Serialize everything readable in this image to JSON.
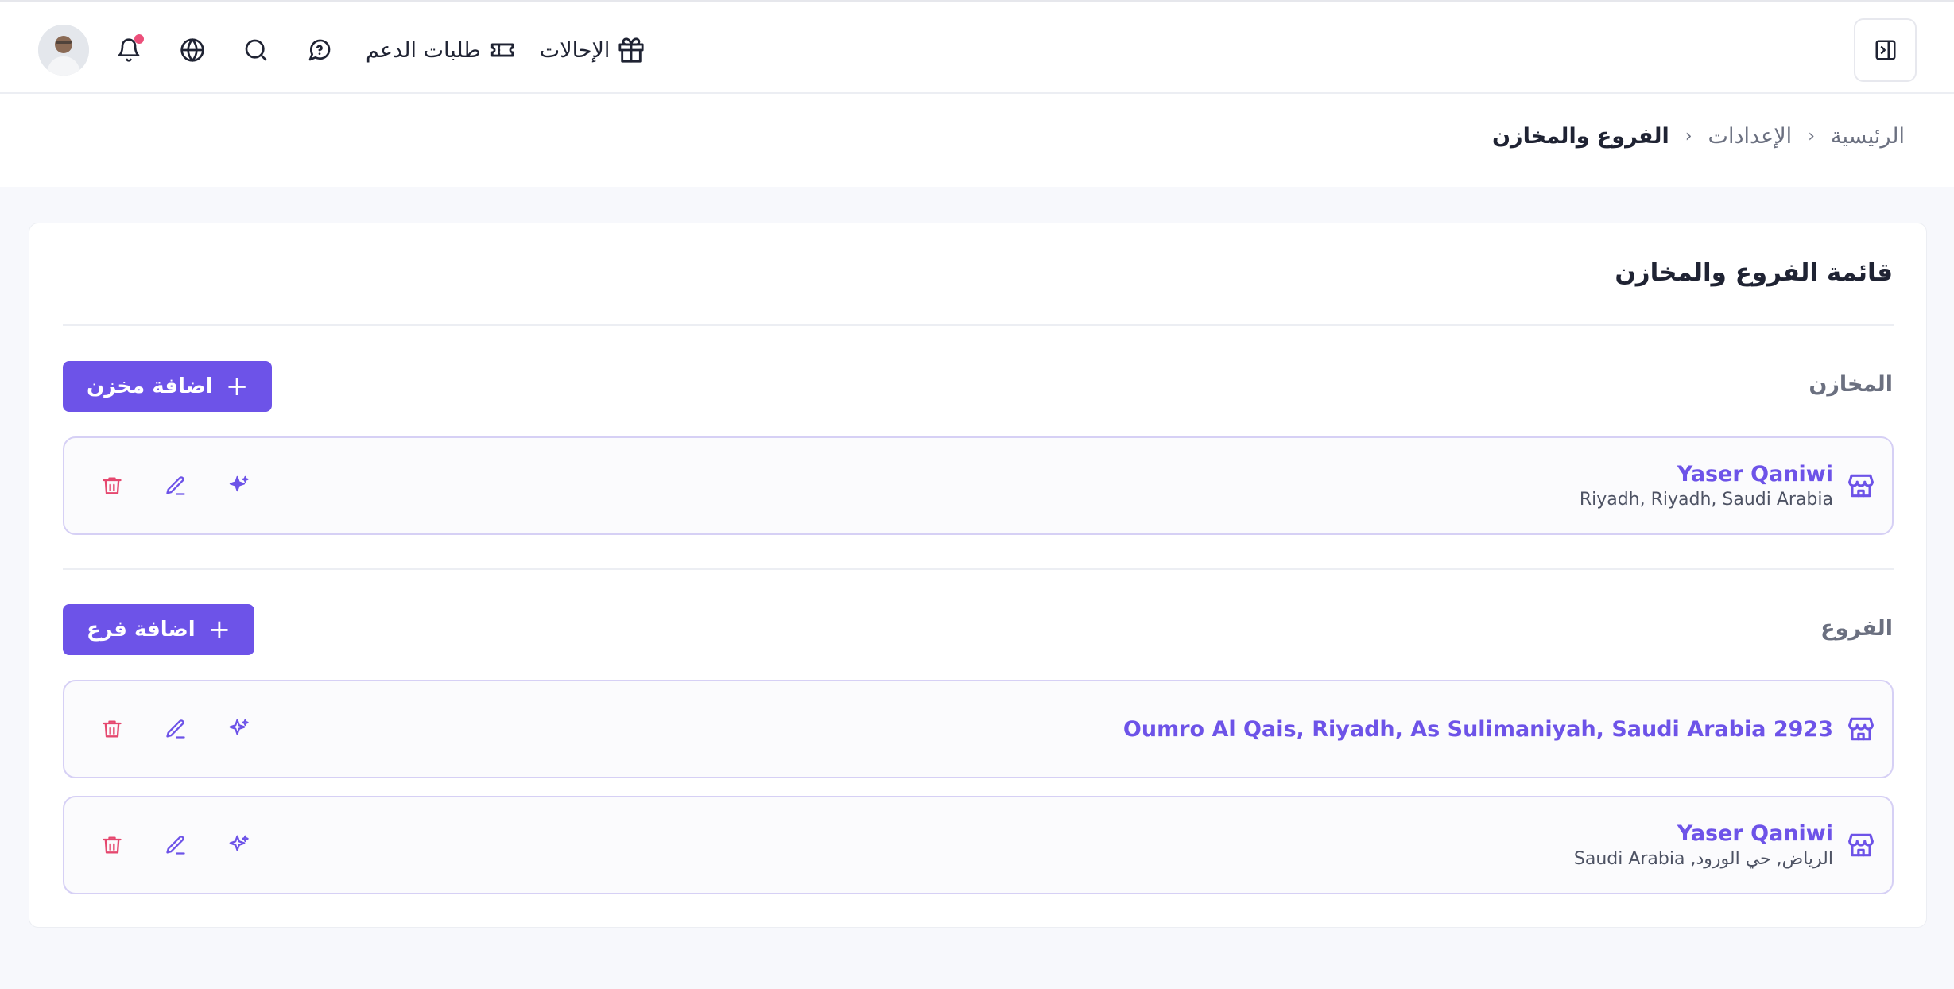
{
  "header": {
    "referrals_label": "الإحالات",
    "support_label": "طلبات الدعم"
  },
  "breadcrumb": {
    "home": "الرئيسية",
    "settings": "الإعدادات",
    "current": "الفروع والمخازن"
  },
  "page": {
    "title": "قائمة الفروع والمخازن"
  },
  "warehouses": {
    "label": "المخازن",
    "add_label": "اضافة مخزن",
    "items": [
      {
        "name": "Yaser Qaniwi",
        "address": "Riyadh, Riyadh, Saudi Arabia"
      }
    ]
  },
  "branches": {
    "label": "الفروع",
    "add_label": "اضافة فرع",
    "items": [
      {
        "name": "Oumro Al Qais, Riyadh, As Sulimaniyah, Saudi Arabia 2923",
        "address": ""
      },
      {
        "name": "Yaser Qaniwi",
        "address": "الرياض, حي الورود, Saudi Arabia"
      }
    ]
  },
  "colors": {
    "accent": "#6d53e8",
    "danger": "#e5486f",
    "notification_dot": "#ec4f7a"
  },
  "icons": {
    "top_nav": [
      "avatar",
      "bell-icon",
      "globe-icon",
      "search-icon",
      "help-chat-icon",
      "ticket-icon",
      "gift-icon"
    ],
    "row_actions": [
      "trash-icon",
      "edit-icon",
      "sparkle-icon"
    ],
    "row_leading": "store-icon"
  }
}
